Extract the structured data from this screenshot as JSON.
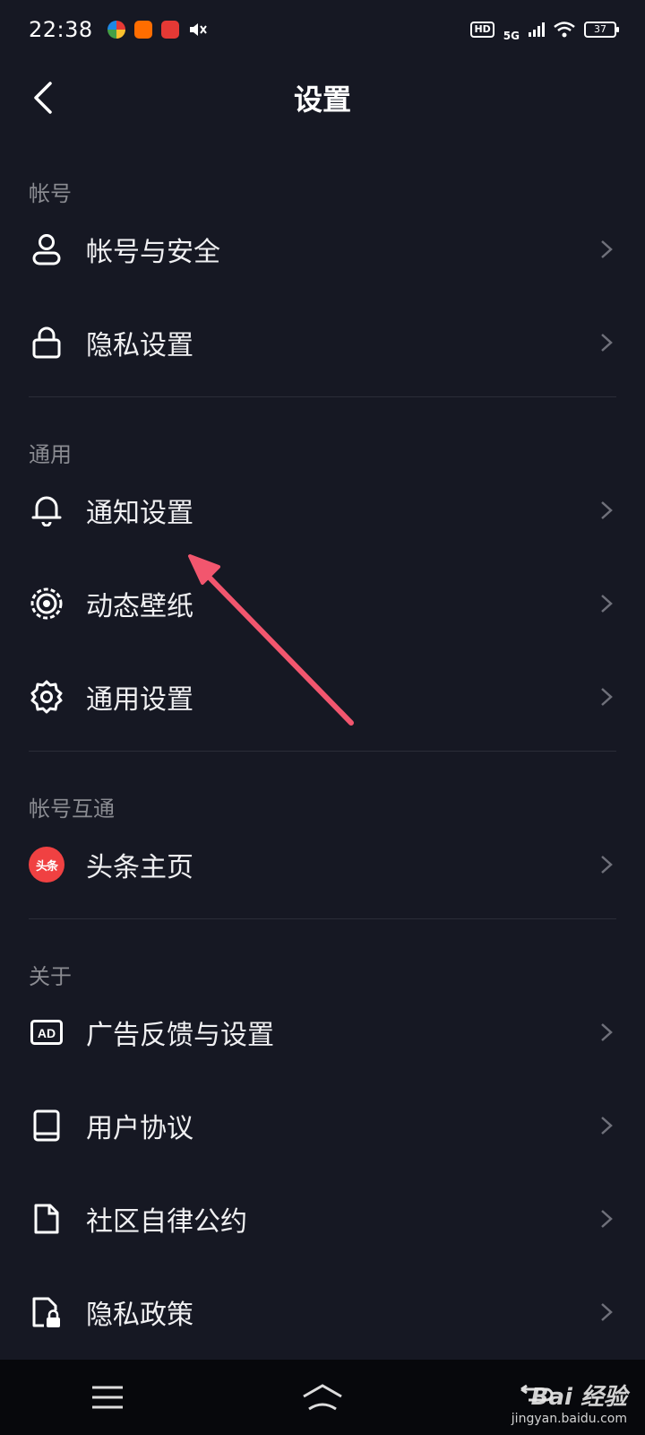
{
  "status_bar": {
    "time": "22:38",
    "network": "5G",
    "hd": "HD",
    "battery": "37"
  },
  "header": {
    "title": "设置"
  },
  "sections": [
    {
      "title": "帐号",
      "items": [
        {
          "label": "帐号与安全",
          "icon": "user-icon"
        },
        {
          "label": "隐私设置",
          "icon": "lock-icon"
        }
      ]
    },
    {
      "title": "通用",
      "items": [
        {
          "label": "通知设置",
          "icon": "bell-icon"
        },
        {
          "label": "动态壁纸",
          "icon": "wallpaper-icon"
        },
        {
          "label": "通用设置",
          "icon": "gear-icon"
        }
      ]
    },
    {
      "title": "帐号互通",
      "items": [
        {
          "label": "头条主页",
          "icon": "toutiao-logo",
          "logo_text": "头条"
        }
      ]
    },
    {
      "title": "关于",
      "items": [
        {
          "label": "广告反馈与设置",
          "icon": "ad-icon"
        },
        {
          "label": "用户协议",
          "icon": "book-icon"
        },
        {
          "label": "社区自律公约",
          "icon": "document-icon"
        },
        {
          "label": "隐私政策",
          "icon": "privacy-doc-icon"
        }
      ]
    }
  ],
  "watermark": {
    "main": "Bai 经验",
    "sub": "jingyan.baidu.com"
  },
  "colors": {
    "background": "#161823",
    "arrow": "#f2566e",
    "toutiao_red": "#f04142"
  }
}
